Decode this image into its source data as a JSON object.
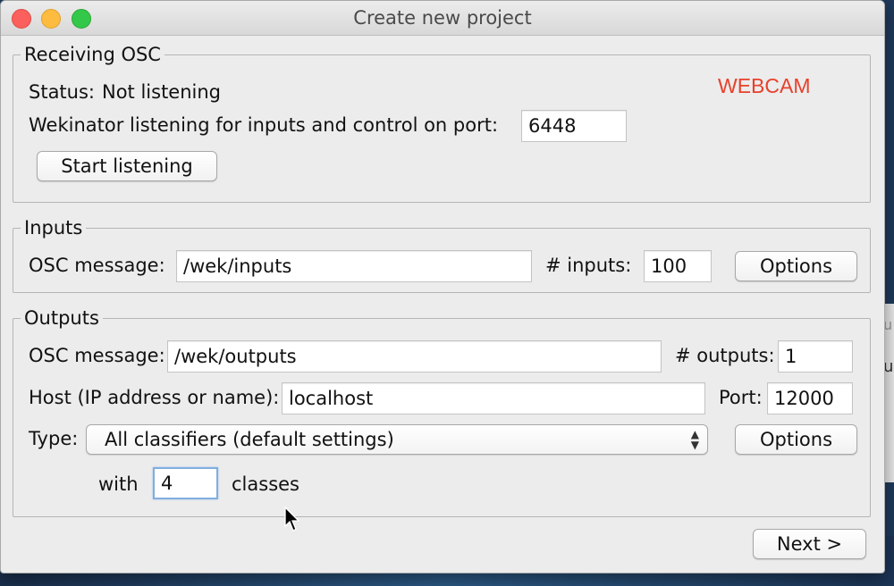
{
  "window": {
    "title": "Create new project"
  },
  "receiving_osc": {
    "legend": "Receiving OSC",
    "status_label": "Status:",
    "status_value": "Not listening",
    "port_label": "Wekinator listening for inputs and control on port:",
    "port_value": "6448",
    "start_button": "Start listening",
    "annotation": "WEBCAM"
  },
  "inputs": {
    "legend": "Inputs",
    "osc_message_label": "OSC message:",
    "osc_message_value": "/wek/inputs",
    "count_label": "# inputs:",
    "count_value": "100",
    "options_button": "Options"
  },
  "outputs": {
    "legend": "Outputs",
    "osc_message_label": "OSC message:",
    "osc_message_value": "/wek/outputs",
    "count_label": "# outputs:",
    "count_value": "1",
    "host_label": "Host (IP address or name):",
    "host_value": "localhost",
    "port_label": "Port:",
    "port_value": "12000",
    "type_label": "Type:",
    "type_selected": "All classifiers (default settings)",
    "options_button": "Options",
    "with_label": "with",
    "classes_value": "4",
    "classes_label": "classes"
  },
  "footer": {
    "next_button": "Next >"
  },
  "colors": {
    "annotation": "#e8412b",
    "focus_ring": "#82aee0"
  }
}
